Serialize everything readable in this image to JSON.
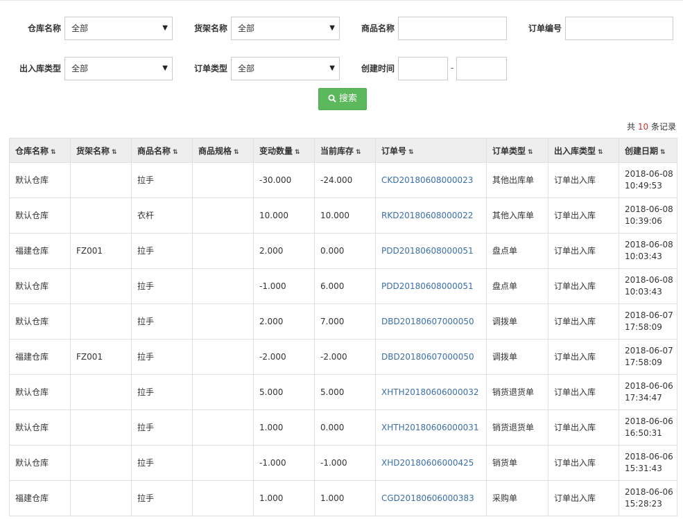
{
  "filters": {
    "warehouse": {
      "label": "仓库名称",
      "value": "全部"
    },
    "shelf": {
      "label": "货架名称",
      "value": "全部"
    },
    "product": {
      "label": "商品名称",
      "value": ""
    },
    "order_no": {
      "label": "订单编号",
      "value": ""
    },
    "io_type": {
      "label": "出入库类型",
      "value": "全部"
    },
    "order_type": {
      "label": "订单类型",
      "value": "全部"
    },
    "created": {
      "label": "创建时间",
      "from": "",
      "to": "",
      "separator": "-"
    }
  },
  "search_button": {
    "label": "搜索",
    "icon": "search-icon"
  },
  "summary": {
    "prefix": "共",
    "count": "10",
    "suffix": "条记录"
  },
  "table": {
    "columns": [
      "仓库名称",
      "货架名称",
      "商品名称",
      "商品规格",
      "变动数量",
      "当前库存",
      "订单号",
      "订单类型",
      "出入库类型",
      "创建日期"
    ],
    "rows": [
      {
        "warehouse": "默认仓库",
        "shelf": "",
        "product": "拉手",
        "spec": "",
        "change": "-30.000",
        "stock": "-24.000",
        "order": "CKD20180608000023",
        "order_type": "其他出库单",
        "io_type": "订单出入库",
        "date": "2018-06-08",
        "time": "10:49:53"
      },
      {
        "warehouse": "默认仓库",
        "shelf": "",
        "product": "衣杆",
        "spec": "",
        "change": "10.000",
        "stock": "10.000",
        "order": "RKD20180608000022",
        "order_type": "其他入库单",
        "io_type": "订单出入库",
        "date": "2018-06-08",
        "time": "10:39:06"
      },
      {
        "warehouse": "福建仓库",
        "shelf": "FZ001",
        "product": "拉手",
        "spec": "",
        "change": "2.000",
        "stock": "0.000",
        "order": "PDD20180608000051",
        "order_type": "盘点单",
        "io_type": "订单出入库",
        "date": "2018-06-08",
        "time": "10:03:43"
      },
      {
        "warehouse": "默认仓库",
        "shelf": "",
        "product": "拉手",
        "spec": "",
        "change": "-1.000",
        "stock": "6.000",
        "order": "PDD20180608000051",
        "order_type": "盘点单",
        "io_type": "订单出入库",
        "date": "2018-06-08",
        "time": "10:03:43"
      },
      {
        "warehouse": "默认仓库",
        "shelf": "",
        "product": "拉手",
        "spec": "",
        "change": "2.000",
        "stock": "7.000",
        "order": "DBD20180607000050",
        "order_type": "调拨单",
        "io_type": "订单出入库",
        "date": "2018-06-07",
        "time": "17:58:09"
      },
      {
        "warehouse": "福建仓库",
        "shelf": "FZ001",
        "product": "拉手",
        "spec": "",
        "change": "-2.000",
        "stock": "-2.000",
        "order": "DBD20180607000050",
        "order_type": "调拨单",
        "io_type": "订单出入库",
        "date": "2018-06-07",
        "time": "17:58:09"
      },
      {
        "warehouse": "默认仓库",
        "shelf": "",
        "product": "拉手",
        "spec": "",
        "change": "5.000",
        "stock": "5.000",
        "order": "XHTH20180606000032",
        "order_type": "销货退货单",
        "io_type": "订单出入库",
        "date": "2018-06-06",
        "time": "17:34:47"
      },
      {
        "warehouse": "默认仓库",
        "shelf": "",
        "product": "拉手",
        "spec": "",
        "change": "1.000",
        "stock": "0.000",
        "order": "XHTH20180606000031",
        "order_type": "销货退货单",
        "io_type": "订单出入库",
        "date": "2018-06-06",
        "time": "16:50:31"
      },
      {
        "warehouse": "默认仓库",
        "shelf": "",
        "product": "拉手",
        "spec": "",
        "change": "-1.000",
        "stock": "-1.000",
        "order": "XHD20180606000425",
        "order_type": "销货单",
        "io_type": "订单出入库",
        "date": "2018-06-06",
        "time": "15:31:43"
      },
      {
        "warehouse": "福建仓库",
        "shelf": "",
        "product": "拉手",
        "spec": "",
        "change": "1.000",
        "stock": "1.000",
        "order": "CGD20180606000383",
        "order_type": "采购单",
        "io_type": "订单出入库",
        "date": "2018-06-06",
        "time": "15:28:23"
      }
    ]
  }
}
